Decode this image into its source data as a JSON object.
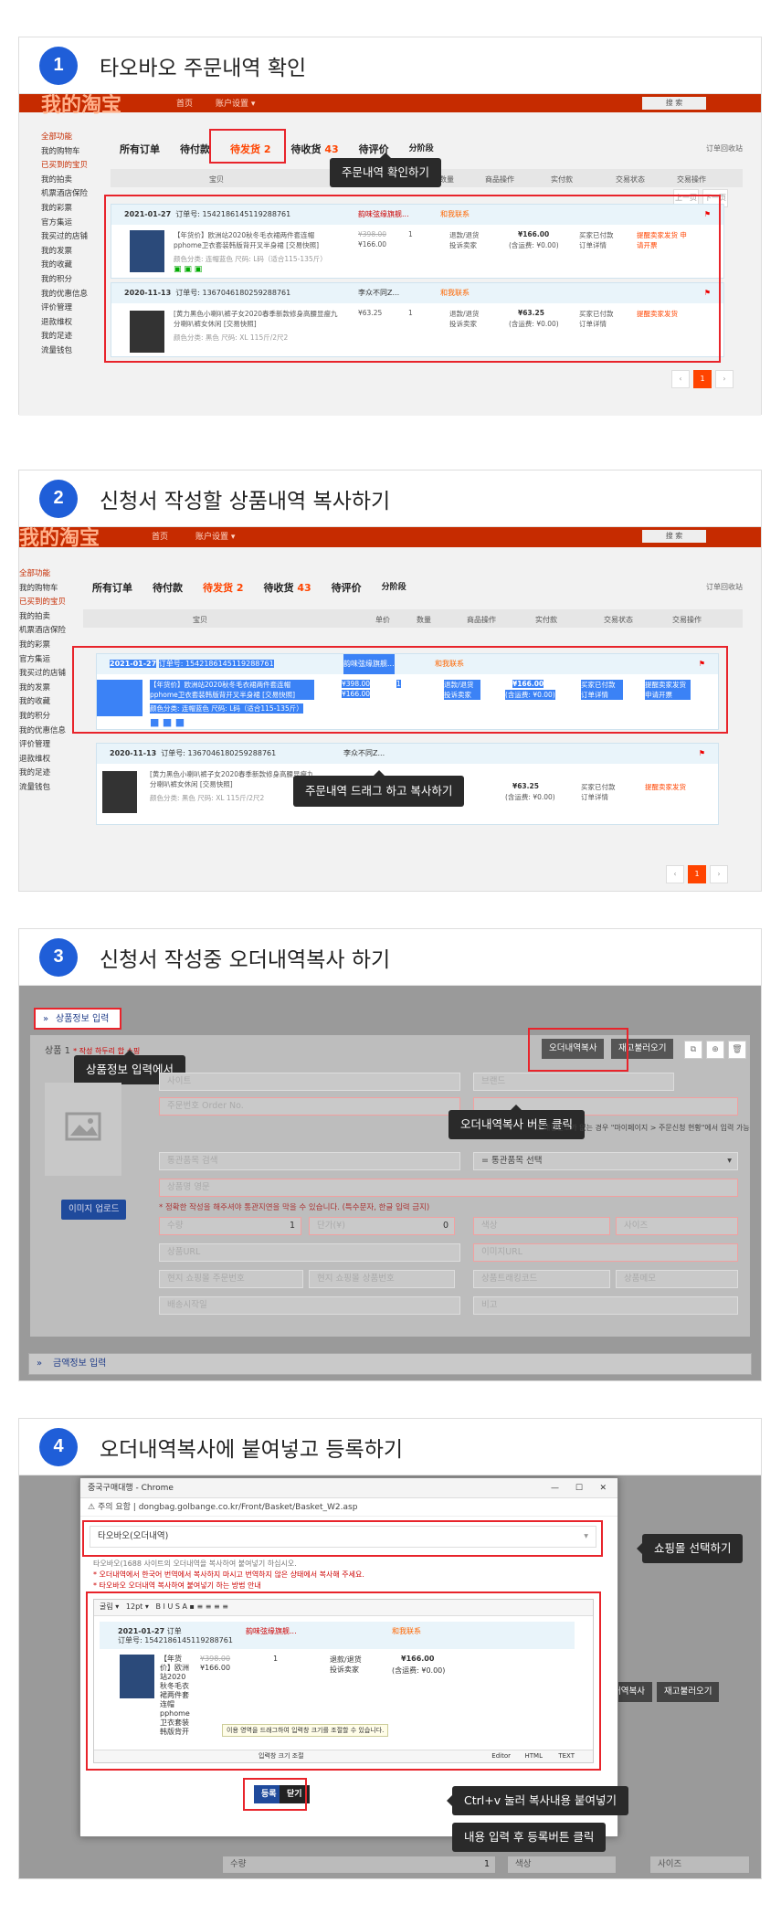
{
  "steps": [
    {
      "num": "1",
      "title": "타오바오 주문내역 확인"
    },
    {
      "num": "2",
      "title": "신청서 작성할 상품내역 복사하기"
    },
    {
      "num": "3",
      "title": "신청서 작성중 오더내역복사 하기"
    },
    {
      "num": "4",
      "title": "오더내역복사에 붙여넣고 등록하기"
    }
  ],
  "taobao": {
    "logo": "我的淘宝",
    "nav_home": "首页",
    "nav_settings": "账户设置 ▾",
    "search_btn": "搜 索",
    "sidebar": [
      "全部功能",
      "我的购物车",
      "已买到的宝贝",
      "我的拍卖",
      "机票酒店保险",
      "我的彩票",
      "官方集运",
      "我买过的店铺",
      "我的发票",
      "我的收藏",
      "我的积分",
      "我的优惠信息",
      "评价管理",
      "退款维权",
      "我的足迹",
      "流量钱包"
    ],
    "tabs": {
      "all": "所有订单",
      "pay": "待付款",
      "ship": "待发货",
      "ship_count": "2",
      "recv": "待收货",
      "recv_count": "43",
      "rate": "待评价",
      "split": "分阶段"
    },
    "recycle": "订单回收站",
    "cols": [
      "宝贝",
      "单价",
      "数量",
      "商品操作",
      "实付款",
      "交易状态",
      "交易操作"
    ],
    "prev": "上一页",
    "next": "下一页",
    "order1": {
      "date": "2021-01-27",
      "no": "订单号: 1542186145119288761",
      "shop": "韵味弦缘旗舰...",
      "contact": "和我联系",
      "title": "【年货价】欧洲站2020秋冬毛衣裙两件套连帽pphome卫衣套装韩版背开叉半身裙 [交易快照]",
      "spec": "颜色分类: 连帽蓝色  尺码: L码（适合115-135斤）",
      "price_old": "¥398.00",
      "price": "¥166.00",
      "qty": "1",
      "ops": "退款/退货 投诉卖家",
      "paid": "¥166.00",
      "paid_note": "(含运费: ¥0.00)",
      "status": "买家已付款 订单详情",
      "action": "提醒卖家发货 申请开票"
    },
    "order2": {
      "date": "2020-11-13",
      "no": "订单号: 1367046180259288761",
      "shop": "李众不同Z...",
      "contact": "和我联系",
      "title": "[黄力黑色小喇叭裤子女2020春季新款修身高腰显瘦九分喇叭裤女休闲 [交易快照]",
      "spec": "颜色分类: 黑色  尺码: XL 115斤/2尺2",
      "price": "¥63.25",
      "qty": "1",
      "ops": "退款/退货 投诉卖家",
      "paid": "¥63.25",
      "paid_note": "(含运费: ¥0.00)",
      "status": "买家已付款 订单详情",
      "action": "提醒卖家发货"
    },
    "page": "1"
  },
  "tips": {
    "s1": "주문내역 확인하기",
    "s2": "주문내역 드래그 하고 복사하기",
    "s3_left": "상품정보 입력에서",
    "s3_right": "오더내역복사 버튼 클릭",
    "s4_mall": "쇼핑몰 선택하기",
    "s4_paste": "Ctrl+v 눌러 복사내용 붙여넣기",
    "s4_submit": "내용 입력 후 등록버튼 클릭"
  },
  "form": {
    "product_section": "상품정보 입력",
    "price_section": "금액정보 입력",
    "product_no": "상품 1",
    "product_note": "* 작성 하두리 합 쇼핑",
    "btn_order_copy": "오더내역복사",
    "btn_stock": "재고불러오기",
    "upload": "이미지 업로드",
    "ph_site": "사이트",
    "ph_brand": "브랜드",
    "ph_orderno": "주문번호 Order No.",
    "ph_customs": "통관품목 검색",
    "customs_select": "= 통관품목 선택",
    "ph_name_en": "상품명 영문",
    "warn": "* 정확한 작성을 해주셔야 통관지연을 막을 수 있습니다. (특수문자, 한글 입력 금지)",
    "ph_qty": "수량",
    "qty_val": "1",
    "ph_unit": "단가(¥)",
    "unit_val": "0",
    "ph_color": "색상",
    "ph_size": "사이즈",
    "ph_url": "상품URL",
    "ph_img_url": "이미지URL",
    "ph_mall_order": "현지 쇼핑몰 주문번호",
    "ph_mall_pno": "현지 쇼핑몰 상품번호",
    "ph_track": "상품트래킹코드",
    "ph_memo": "상품메모",
    "ph_ship_start": "배송시작일",
    "ph_note": "비고",
    "hint": "* 트래킹번호가 없는 경우 \"마이페이지 > 주문신청 현황\"에서 입력 가능"
  },
  "popup": {
    "title": "중국구매대행 - Chrome",
    "url": "dongbag.golbange.co.kr/Front/Basket/Basket_W2.asp",
    "secure": "주의 요함",
    "mall_select": "타오바오(오더내역)",
    "note1": "타오바오(1688 사이트의 오더내역을 복사하여 붙여넣기 하십시오.",
    "note2": "* 오더내역에서 한국어 번역에서 복사하지 마시고 번역하지 않은 상태에서 복사해 주세요.",
    "note3": "* 타오바오 오더내역 복사하여 붙여넣기 하는 방법 안내",
    "toolbar_font": "굴림",
    "toolbar_size": "12pt",
    "editor_tip": "이용 영역을 드래그하여 입력창 크기를 조절할 수 있습니다.",
    "resize": "입력창 크기 조절",
    "tab_editor": "Editor",
    "tab_html": "HTML",
    "tab_text": "TEXT",
    "btn_register": "등록",
    "btn_close": "닫기",
    "bg_btn1": "내역복사",
    "bg_btn2": "재고불러오기"
  }
}
